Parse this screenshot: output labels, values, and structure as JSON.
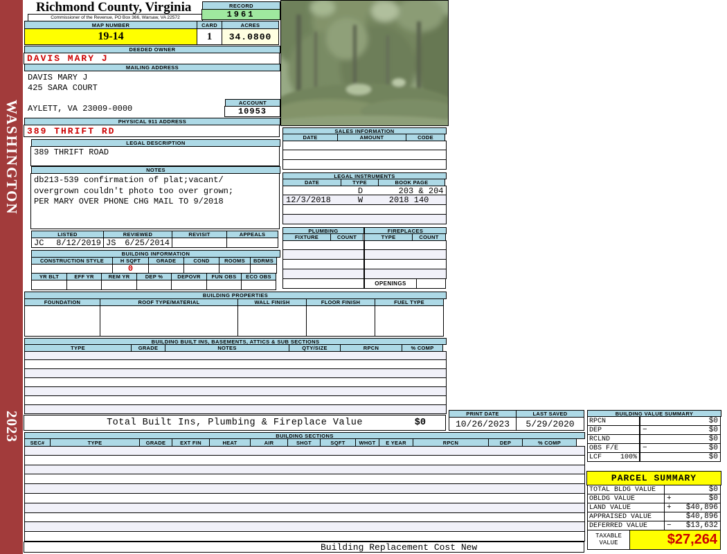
{
  "colors": {
    "header_blue": "#ADD9E6",
    "highlight_yellow": "#FFFF00",
    "record_green": "#9FE89F",
    "acres_cream": "#FFFFE1",
    "alert_red": "#CC0000",
    "sidebar_brick": "#A23B3B"
  },
  "sidebar": {
    "vertical_title": "WASHINGTON",
    "vertical_year": "2023"
  },
  "header": {
    "title": "Richmond County, Virginia",
    "subtitle": "Commissioner of the Revenue, PO Box 366, Warsaw, VA 22572",
    "record_label": "RECORD",
    "record_value": "1961",
    "map_number_label": "MAP NUMBER",
    "map_number_value": "19-14",
    "card_label": "CARD",
    "card_value": "1",
    "acres_label": "ACRES",
    "acres_value": "34.0800"
  },
  "owner": {
    "deeded_owner_label": "DEEDED OWNER",
    "deeded_owner": "DAVIS MARY J",
    "mailing_address_label": "MAILING ADDRESS",
    "mailing_line1": "DAVIS MARY J",
    "mailing_line2": "425 SARA COURT",
    "mailing_line3": "",
    "mailing_line4": "AYLETT, VA 23009-0000",
    "account_label": "ACCOUNT",
    "account_value": "10953",
    "physical_address_label": "PHYSICAL 911 ADDRESS",
    "physical_address": "389 THRIFT RD",
    "legal_description_label": "LEGAL DESCRIPTION",
    "legal_description": "389 THRIFT ROAD",
    "notes_label": "NOTES",
    "notes_line1": "db213-539 confirmation of plat;vacant/",
    "notes_line2": "overgrown couldn't photo too over grown;",
    "notes_line3": "PER MARY OVER PHONE CHG MAIL TO 9/2018"
  },
  "review": {
    "headers": [
      "LISTED",
      "REVIEWED",
      "REVISIT",
      "APPEALS"
    ],
    "listed_by": "JC",
    "listed_date": "8/12/2019",
    "reviewed_by": "JS",
    "reviewed_date": "6/25/2014",
    "revisit": "",
    "appeals": ""
  },
  "building_information": {
    "title": "BUILDING INFORMATION",
    "row1_headers": [
      "CONSTRUCTION STYLE",
      "H SQFT",
      "GRADE",
      "COND",
      "ROOMS",
      "BDRMS"
    ],
    "h_sqft": "0",
    "row2_headers": [
      "YR BLT",
      "EFF YR",
      "REM YR",
      "DEP %",
      "DEPOVR",
      "FUN OBS",
      "ECO OBS"
    ]
  },
  "building_properties": {
    "title": "BUILDING PROPERTIES",
    "headers": [
      "FOUNDATION",
      "ROOF TYPE/MATERIAL",
      "WALL FINISH",
      "FLOOR FINISH",
      "FUEL TYPE"
    ]
  },
  "built_ins": {
    "title": "BUILDING BUILT INS, BASEMENTS, ATTICS & SUB SECTIONS",
    "headers": [
      "TYPE",
      "GRADE",
      "NOTES",
      "QTY/SIZE",
      "RPCN",
      "% COMP"
    ],
    "total_label": "Total Built Ins, Plumbing & Fireplace Value",
    "total_value": "$0"
  },
  "sales": {
    "title": "SALES INFORMATION",
    "headers": [
      "DATE",
      "AMOUNT",
      "CODE"
    ]
  },
  "legal_instruments": {
    "title": "LEGAL INSTRUMENTS",
    "headers": [
      "DATE",
      "TYPE",
      "BOOK PAGE"
    ],
    "rows": [
      {
        "date": "",
        "type": "D",
        "book_page": "203 & 204"
      },
      {
        "date": "12/3/2018",
        "type": "W",
        "book_page": "2018 140"
      }
    ]
  },
  "plumbing": {
    "title": "PLUMBING",
    "headers": [
      "FIXTURE",
      "COUNT"
    ]
  },
  "fireplaces": {
    "title": "FIREPLACES",
    "headers": [
      "TYPE",
      "COUNT"
    ],
    "openings_label": "OPENINGS"
  },
  "print_info": {
    "print_date_label": "PRINT DATE",
    "print_date": "10/26/2023",
    "last_saved_label": "LAST SAVED",
    "last_saved": "5/29/2020"
  },
  "building_sections": {
    "title": "BUILDING SECTIONS",
    "headers": [
      "SEC#",
      "TYPE",
      "GRADE",
      "EXT FIN",
      "HEAT",
      "AIR",
      "SHGT",
      "SQFT",
      "WHGT",
      "E YEAR",
      "RPCN",
      "DEP",
      "% COMP"
    ],
    "footer": "Building Replacement Cost New"
  },
  "building_value_summary": {
    "title": "BUILDING VALUE SUMMARY",
    "rows": [
      {
        "label": "RPCN",
        "pct": "",
        "op": "",
        "value": "$0"
      },
      {
        "label": "DEP",
        "pct": "",
        "op": "−",
        "value": "$0"
      },
      {
        "label": "RCLND",
        "pct": "",
        "op": "",
        "value": "$0"
      },
      {
        "label": "OBS F/E",
        "pct": "",
        "op": "−",
        "value": "$0"
      },
      {
        "label": "LCF",
        "pct": "100%",
        "op": "",
        "value": "$0"
      }
    ]
  },
  "parcel_summary": {
    "title": "PARCEL SUMMARY",
    "rows": [
      {
        "label": "TOTAL BLDG VALUE",
        "op": "",
        "value": "$0"
      },
      {
        "label": "OBLDG VALUE",
        "op": "+",
        "value": "$0"
      },
      {
        "label": "LAND VALUE",
        "op": "+",
        "value": "$40,896"
      },
      {
        "label": "APPRAISED VALUE",
        "op": "",
        "value": "$40,896"
      },
      {
        "label": "DEFERRED VALUE",
        "op": "−",
        "value": "$13,632"
      }
    ],
    "taxable_label": "TAXABLE VALUE",
    "taxable_value": "$27,264"
  },
  "photo": {
    "alt": "wooded property photo"
  }
}
